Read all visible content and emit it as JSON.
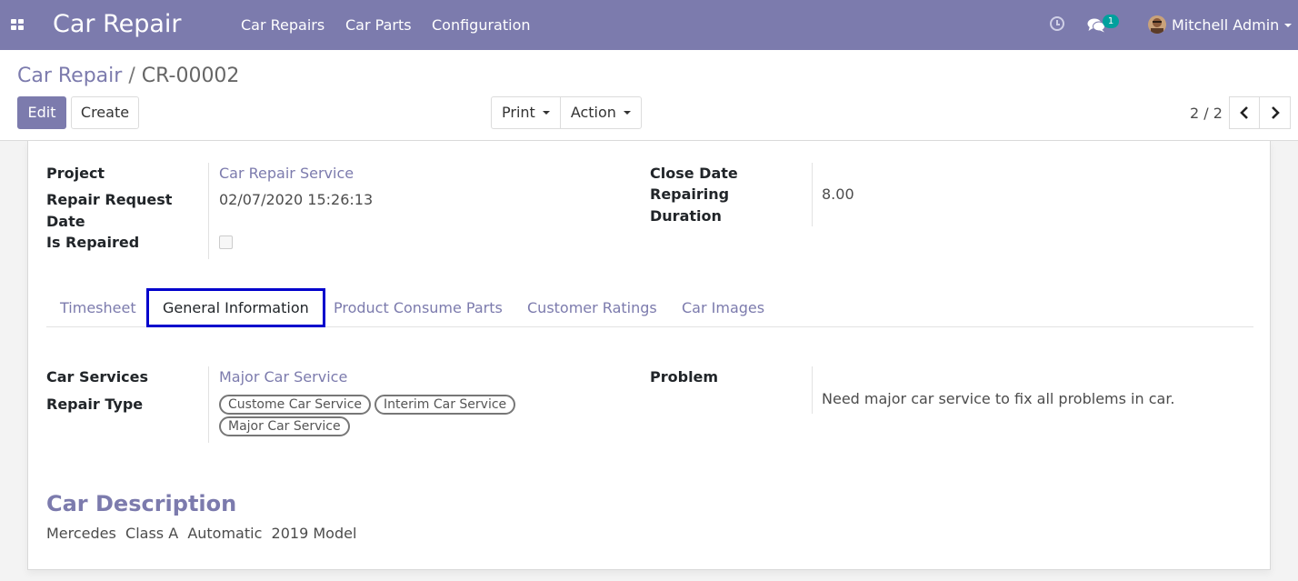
{
  "navbar": {
    "apps_icon": "apps-grid-icon",
    "brand": "Car Repair",
    "menu": [
      "Car Repairs",
      "Car Parts",
      "Configuration"
    ],
    "activity_icon": "clock-icon",
    "messages_icon": "chat-icon",
    "messages_count": "1",
    "user_name": "Mitchell Admin",
    "color": "#7c7bad"
  },
  "breadcrumb": {
    "parent": "Car Repair",
    "separator": "/",
    "current": "CR-00002"
  },
  "buttons": {
    "edit": "Edit",
    "create": "Create",
    "print": "Print",
    "action": "Action"
  },
  "pager": {
    "value": "2 / 2",
    "prev_icon": "chevron-left-icon",
    "next_icon": "chevron-right-icon"
  },
  "header_fields": {
    "project_label": "Project",
    "project_value": "Car Repair Service",
    "request_date_label_1": "Repair Request",
    "request_date_label_2": "Date",
    "request_date_value": "02/07/2020 15:26:13",
    "is_repaired_label": "Is Repaired",
    "is_repaired_value": false,
    "close_date_label": "Close Date",
    "close_date_value": "",
    "duration_label_1": "Repairing",
    "duration_label_2": "Duration",
    "duration_value": "8.00"
  },
  "tabs": [
    {
      "label": "Timesheet",
      "active": false
    },
    {
      "label": "General Information",
      "active": true
    },
    {
      "label": "Product Consume Parts",
      "active": false
    },
    {
      "label": "Customer Ratings",
      "active": false
    },
    {
      "label": "Car Images",
      "active": false
    }
  ],
  "general_info": {
    "car_services_label": "Car Services",
    "car_services_value": "Major Car Service",
    "repair_type_label": "Repair Type",
    "repair_type_tags": [
      "Custome Car Service",
      "Interim Car Service",
      "Major Car Service"
    ],
    "problem_label": "Problem",
    "problem_value": "Need major car service to fix all problems in car."
  },
  "car_description": {
    "title": "Car Description",
    "text": "Mercedes  Class A  Automatic  2019 Model"
  }
}
